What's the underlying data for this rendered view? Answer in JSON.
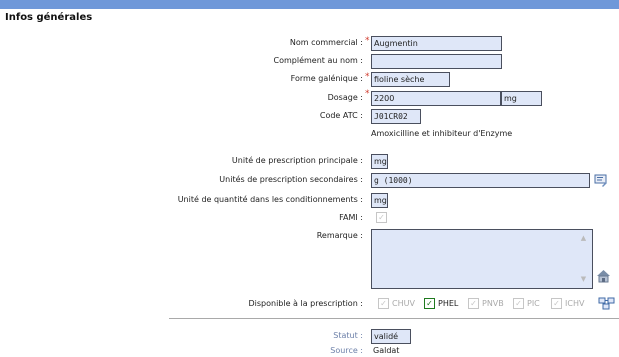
{
  "section": {
    "title": "Infos générales"
  },
  "fields": {
    "nom_commercial": {
      "label": "Nom commercial :",
      "value": "Augmentin",
      "required": "*"
    },
    "complement_nom": {
      "label": "Complément au nom :",
      "value": ""
    },
    "forme_galenique": {
      "label": "Forme galénique :",
      "value": "fioline sèche",
      "required": "*"
    },
    "dosage": {
      "label": "Dosage :",
      "value": "2200",
      "unit": "mg",
      "required": "*"
    },
    "code_atc": {
      "label": "Code ATC :",
      "value": "J01CR02",
      "description": "Amoxicilline et inhibiteur d'Enzyme"
    },
    "unite_principale": {
      "label": "Unité de prescription principale :",
      "value": "mg"
    },
    "unites_secondaires": {
      "label": "Unités de prescription secondaires :",
      "value": "g (1000)"
    },
    "unite_quantite": {
      "label": "Unité de quantité dans les conditionnements :",
      "value": "mg"
    },
    "fami": {
      "label": "FAMI :",
      "checked": true
    },
    "remarque": {
      "label": "Remarque :",
      "value": ""
    },
    "disponible": {
      "label": "Disponible à la prescription :",
      "options": [
        {
          "label": "CHUV",
          "checked": true,
          "enabled": false
        },
        {
          "label": "PHEL",
          "checked": true,
          "enabled": true
        },
        {
          "label": "PNVB",
          "checked": true,
          "enabled": false
        },
        {
          "label": "PIC",
          "checked": true,
          "enabled": false
        },
        {
          "label": "ICHV",
          "checked": true,
          "enabled": false
        }
      ]
    },
    "statut": {
      "label": "Statut :",
      "value": "validé"
    },
    "source": {
      "label": "Source :",
      "value": "Galdat"
    }
  },
  "icons": {
    "secondary_units": "edit-list-icon",
    "remarque": "home-icon",
    "disponible": "network-icon"
  },
  "colors": {
    "header": "#6f98d9",
    "field_bg": "#dfe7f8",
    "required": "#d13b2d",
    "checkbox_active": "#157315"
  }
}
